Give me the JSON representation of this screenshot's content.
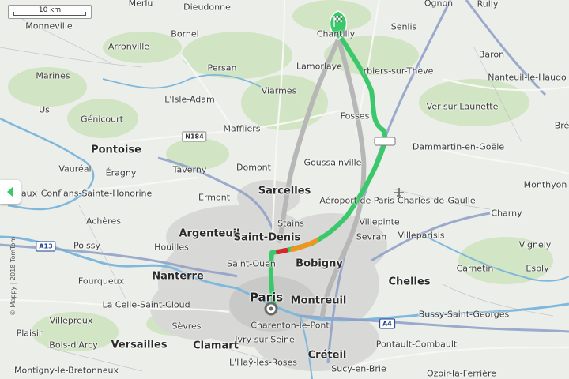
{
  "scale": {
    "label": "10 km"
  },
  "copyright": "© Mappy | 2018 TomTom",
  "colors": {
    "route": "#3bc86a",
    "route_alt": "#b7b7b7",
    "traffic_red": "#d9262c",
    "traffic_orange": "#f0961e",
    "water": "#7fb8dd",
    "urban": "#d9d9d9"
  },
  "icons": {
    "destination": "checkered-flag-icon",
    "origin": "origin-circle-icon",
    "panel_toggle": "chevron-left-icon",
    "airport": "plane-icon"
  },
  "places": {
    "merlu": "Merlu",
    "dieudonne": "Dieudonne",
    "monneville": "Monneville",
    "arronville": "Arronville",
    "bornel": "Bornel",
    "chantilly": "Chantilly",
    "senlis": "Senlis",
    "ognon": "Ognon",
    "rully": "Rully",
    "baron": "Baron",
    "marines": "Marines",
    "persan": "Persan",
    "lamorlaye": "Lamorlaye",
    "orry": "rbiers-sur-Thève",
    "nanteuil": "Nanteuil-le-Haudo",
    "lisle_adam": "L'Isle-Adam",
    "viarmes": "Viarmes",
    "us": "Us",
    "genicourt": "Génicourt",
    "maffliers": "Maffliers",
    "fosses": "Fosses",
    "ver": "Ver-sur-Launette",
    "bre": "Bré",
    "pontoise": "Pontoise",
    "dammartin": "Dammartin-en-Goële",
    "vaureal": "Vauréal",
    "eragny": "Éragny",
    "taverny": "Taverny",
    "domont": "Domont",
    "goussainville": "Goussainville",
    "monthyon": "Monthyon",
    "aux": "aux",
    "conflans": "Conflans-Sainte-Honorine",
    "ermont": "Ermont",
    "sarcelles": "Sarcelles",
    "cdg": "Aéroport de Paris-Charles-de-Gaulle",
    "acheres": "Achères",
    "stains": "Stains",
    "charny": "Charny",
    "argenteuil": "Argenteuil",
    "villepinte": "Villepinte",
    "saint_denis": "Saint-Denis",
    "sevran": "Sevran",
    "villeparisis": "Villeparisis",
    "houilles": "Houilles",
    "poissy": "Poissy",
    "vignely": "Vignely",
    "saint_ouen": "Saint-Ouen",
    "bobigny": "Bobigny",
    "carnetin": "Carnetin",
    "esbly": "Esbly",
    "nanterre": "Nanterre",
    "fourqueux": "Fourqueux",
    "chelles": "Chelles",
    "paris": "Paris",
    "montreuil": "Montreuil",
    "la_celle": "La Celle-Saint-Cloud",
    "bussy": "Bussy-Saint-Georges",
    "villepreux": "Villepreux",
    "charenton": "Charenton-le-Pont",
    "sevres": "Sèvres",
    "plaisir": "Plaisir",
    "bois_darcy": "Bois-d'Arcy",
    "versailles": "Versailles",
    "clamart": "Clamart",
    "ivry": "Ivry-sur-Seine",
    "pontault": "Pontault-Combault",
    "lhay": "L'Haÿ-les-Roses",
    "creteil": "Créteil",
    "montigny": "Montigny-le-Bretonneux",
    "sucy": "Sucy-en-Brie",
    "ozoir": "Ozoir-la-Ferrière"
  },
  "roads": {
    "n184": "N184",
    "a13": "A13",
    "a4": "A4"
  }
}
